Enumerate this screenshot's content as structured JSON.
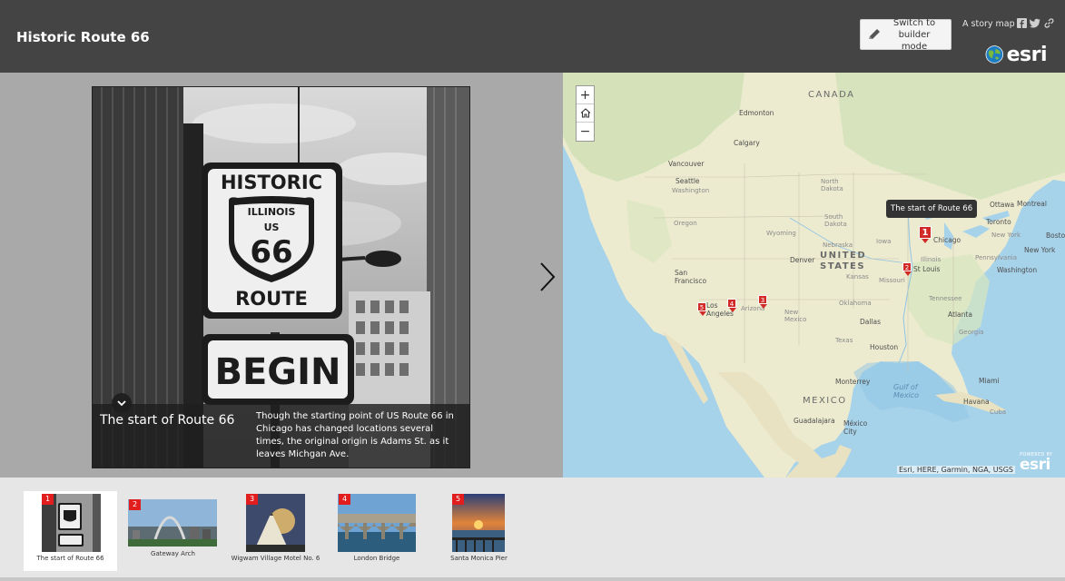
{
  "header": {
    "title": "Historic Route 66",
    "builder_button": "Switch to\nbuilder mode",
    "story_label": "A story map",
    "esri_logo": "esri"
  },
  "section": {
    "caption_title": "The start of Route 66",
    "caption_text": "Though the starting point of US Route 66 in Chicago has changed locations several times, the original origin is Adams St. as it leaves Michgan Ave.",
    "sign_text": [
      "HISTORIC",
      "ILLINOIS",
      "US",
      "66",
      "ROUTE",
      "BEGIN"
    ]
  },
  "map": {
    "tooltip": "The start of Route 66",
    "zoom_in": "+",
    "zoom_out": "−",
    "attribution": "Esri, HERE, Garmin, NGA, USGS",
    "powered_by": "POWERED BY",
    "powered_logo": "esri",
    "labels": {
      "canada": "CANADA",
      "united_states": "UNITED\nSTATES",
      "mexico": "MEXICO",
      "edmonton": "Edmonton",
      "calgary": "Calgary",
      "vancouver": "Vancouver",
      "seattle": "Seattle",
      "washington": "Washington",
      "oregon": "Oregon",
      "north_dakota": "North\nDakota",
      "south_dakota": "South\nDakota",
      "wyoming": "Wyoming",
      "nebraska": "Nebraska",
      "denver": "Denver",
      "kansas": "Kansas",
      "san_francisco": "San\nFrancisco",
      "los_angeles": "Los\nAngeles",
      "arizona": "Arizona",
      "new_mexico": "New\nMexico",
      "oklahoma": "Oklahoma",
      "dallas": "Dallas",
      "texas": "Texas",
      "houston": "Houston",
      "chicago": "Chicago",
      "st_louis": "St Louis",
      "missouri": "Missouri",
      "iowa": "Iowa",
      "illinois": "Illinois",
      "ottawa": "Ottawa",
      "montreal": "Montreal",
      "toronto": "Toronto",
      "new_york_state": "New York",
      "new_york_city": "New York",
      "boston": "Boston",
      "pennsylvania": "Pennsylvania",
      "washington_dc": "Washington",
      "atlanta": "Atlanta",
      "georgia": "Georgia",
      "tennessee": "Tennessee",
      "miami": "Miami",
      "monterrey": "Monterrey",
      "guadalajara": "Guadalajara",
      "mexico_city": "México\nCity",
      "havana": "Havana",
      "gulf_of_mexico": "Gulf of\nMexico",
      "cuba": "Cuba"
    },
    "pins": [
      {
        "number": "1"
      },
      {
        "number": "2"
      },
      {
        "number": "3"
      },
      {
        "number": "4"
      },
      {
        "number": "5"
      }
    ]
  },
  "thumbnails": [
    {
      "number": "1",
      "label": "The start of Route 66"
    },
    {
      "number": "2",
      "label": "Gateway Arch"
    },
    {
      "number": "3",
      "label": "Wigwam Village Motel No. 6"
    },
    {
      "number": "4",
      "label": "London Bridge"
    },
    {
      "number": "5",
      "label": "Santa Monica Pier"
    }
  ],
  "colors": {
    "header_bg": "#444444",
    "accent_red": "#d12a27",
    "map_water": "#a6d2ea",
    "map_land": "#e8e4c8"
  }
}
